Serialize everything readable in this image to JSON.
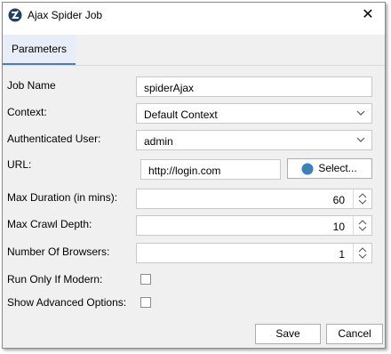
{
  "window": {
    "title": "Ajax Spider Job",
    "close_icon": "close-icon"
  },
  "tabs": [
    {
      "label": "Parameters",
      "selected": true
    }
  ],
  "form": {
    "job_name": {
      "label": "Job Name",
      "value": "spiderAjax"
    },
    "context": {
      "label": "Context:",
      "value": "Default Context"
    },
    "auth_user": {
      "label": "Authenticated User:",
      "value": "admin"
    },
    "url": {
      "label": "URL:",
      "value": "http://login.com",
      "select_label": "Select..."
    },
    "max_duration": {
      "label": "Max Duration (in mins):",
      "value": "60"
    },
    "max_crawl_depth": {
      "label": "Max Crawl Depth:",
      "value": "10"
    },
    "num_browsers": {
      "label": "Number Of Browsers:",
      "value": "1"
    },
    "run_only_if_modern": {
      "label": "Run Only If Modern:",
      "checked": false
    },
    "show_advanced": {
      "label": "Show Advanced Options:",
      "checked": false
    }
  },
  "footer": {
    "save_label": "Save",
    "cancel_label": "Cancel"
  },
  "colors": {
    "tab_accent": "#4a7ebb",
    "panel_bg": "#f0f0f0"
  }
}
